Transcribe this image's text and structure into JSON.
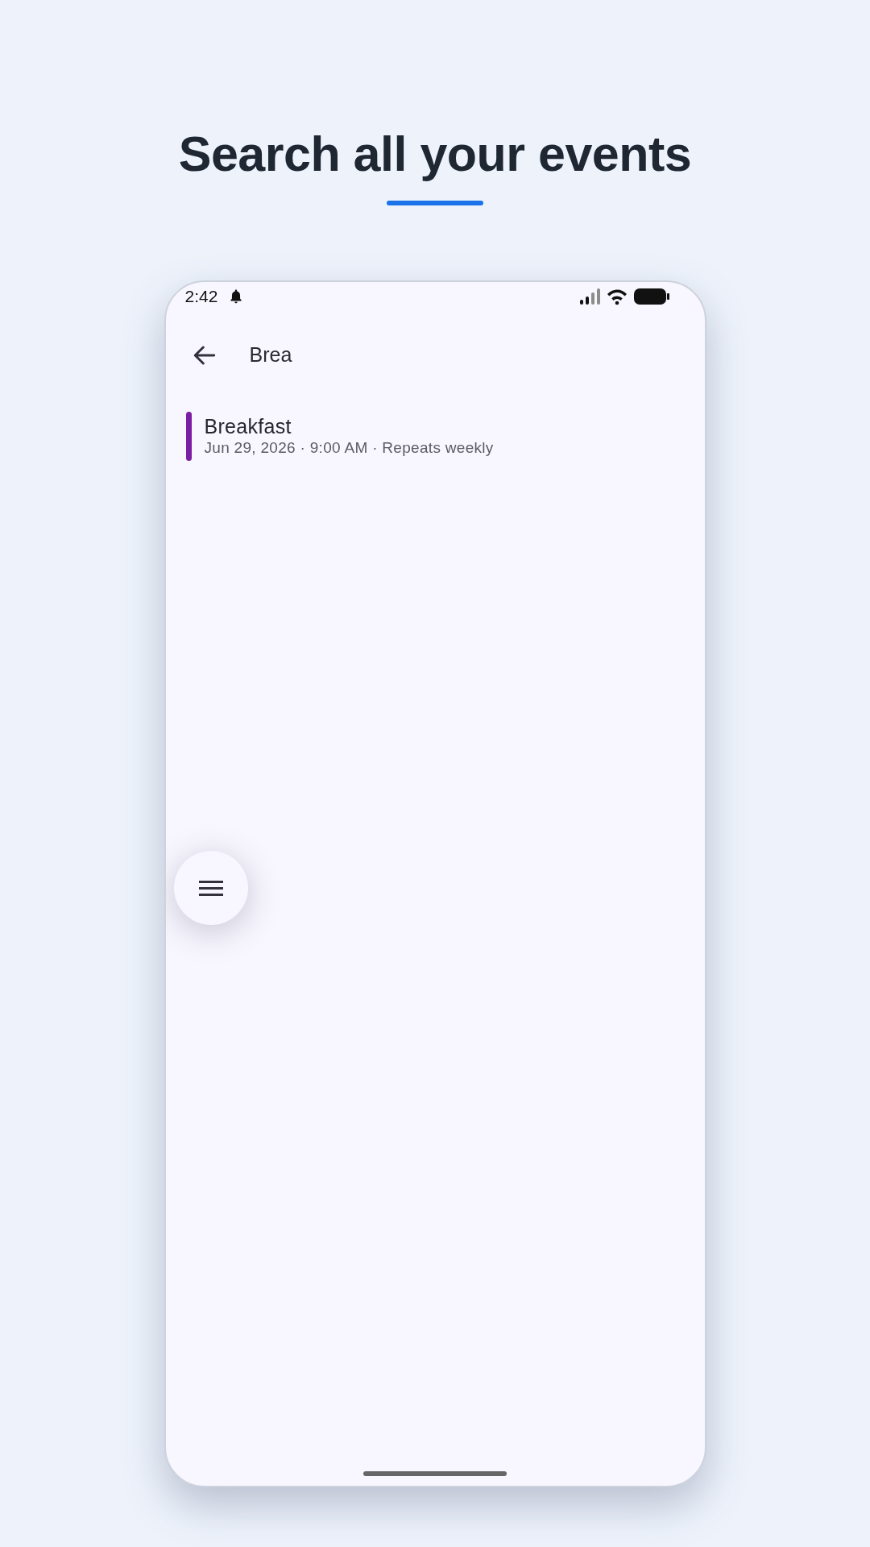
{
  "headline": {
    "title": "Search all your events"
  },
  "phone": {
    "status_bar": {
      "time": "2:42"
    },
    "search": {
      "value": "Brea"
    },
    "results": [
      {
        "title": "Breakfast",
        "details": "Jun 29, 2026 · 9:00 AM · Repeats weekly",
        "color": "#7b1fa2"
      }
    ]
  }
}
